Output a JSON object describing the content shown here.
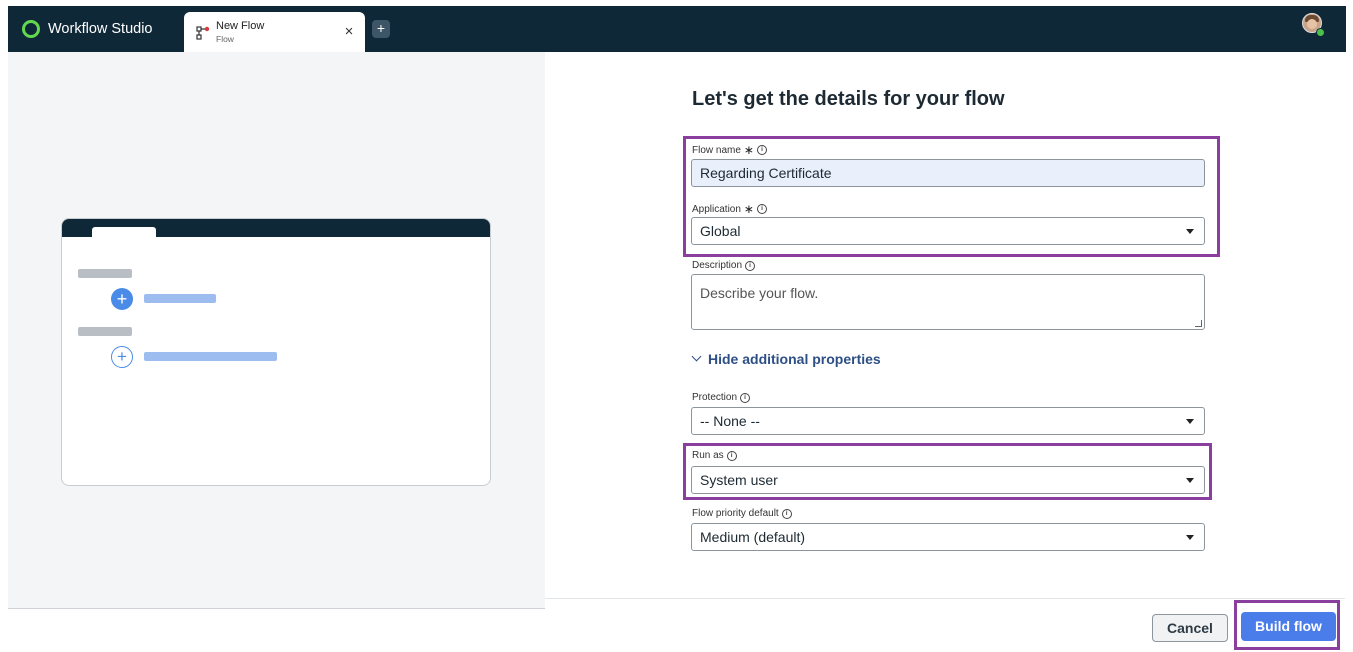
{
  "app": {
    "title": "Workflow Studio"
  },
  "tab": {
    "title": "New Flow",
    "subtitle": "Flow",
    "close": "×",
    "add": "+"
  },
  "form": {
    "heading": "Let's get the details for your flow",
    "flow_name": {
      "label": "Flow name",
      "required_mark": "∗",
      "value": "Regarding Certificate"
    },
    "application": {
      "label": "Application",
      "required_mark": "∗",
      "value": "Global"
    },
    "description": {
      "label": "Description",
      "placeholder": "Describe your flow."
    },
    "toggle_label": "Hide additional properties",
    "protection": {
      "label": "Protection",
      "value": "-- None --"
    },
    "run_as": {
      "label": "Run as",
      "value": "System user"
    },
    "priority": {
      "label": "Flow priority default",
      "value": "Medium (default)"
    }
  },
  "footer": {
    "cancel_label": "Cancel",
    "build_label": "Build flow"
  },
  "colors": {
    "topbar": "#0f2838",
    "accent": "#4a7cea",
    "highlight": "#8a3f9e",
    "brand_logo": "#62d84e"
  }
}
